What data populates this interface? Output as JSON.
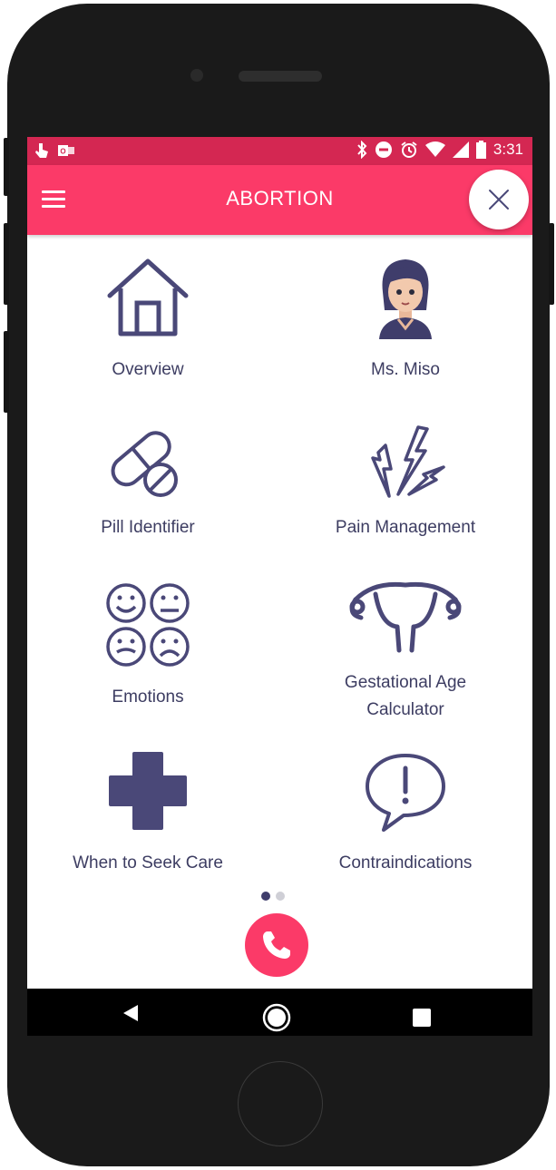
{
  "status_bar": {
    "time": "3:31",
    "icons": [
      "touch-icon",
      "outlook-icon",
      "bluetooth-icon",
      "do-not-disturb-icon",
      "alarm-icon",
      "wifi-icon",
      "signal-icon",
      "battery-icon"
    ]
  },
  "app_bar": {
    "title": "ABORTION",
    "menu_icon": "hamburger-menu-icon",
    "close_icon": "close-icon"
  },
  "tiles": [
    {
      "label": "Overview",
      "icon": "house-icon"
    },
    {
      "label": "Ms. Miso",
      "icon": "ms-miso-avatar"
    },
    {
      "label": "Pill Identifier",
      "icon": "pill-icon"
    },
    {
      "label": "Pain Management",
      "icon": "lightning-icon"
    },
    {
      "label": "Emotions",
      "icon": "emotions-faces-icon"
    },
    {
      "label_line1": "Gestational Age",
      "label_line2": "Calculator",
      "icon": "uterus-icon"
    },
    {
      "label": "When to Seek Care",
      "icon": "medical-cross-icon"
    },
    {
      "label": "Contraindications",
      "icon": "speech-bubble-exclamation-icon"
    }
  ],
  "pager": {
    "pages": 2,
    "active": 1
  },
  "call_button": {
    "icon": "phone-icon"
  },
  "colors": {
    "accent": "#fb3a68",
    "status_bar": "#d42752",
    "icon": "#4a4878",
    "text": "#3d3d62"
  },
  "nav_bar": {
    "icons": [
      "back-icon",
      "home-icon",
      "recents-icon"
    ]
  }
}
